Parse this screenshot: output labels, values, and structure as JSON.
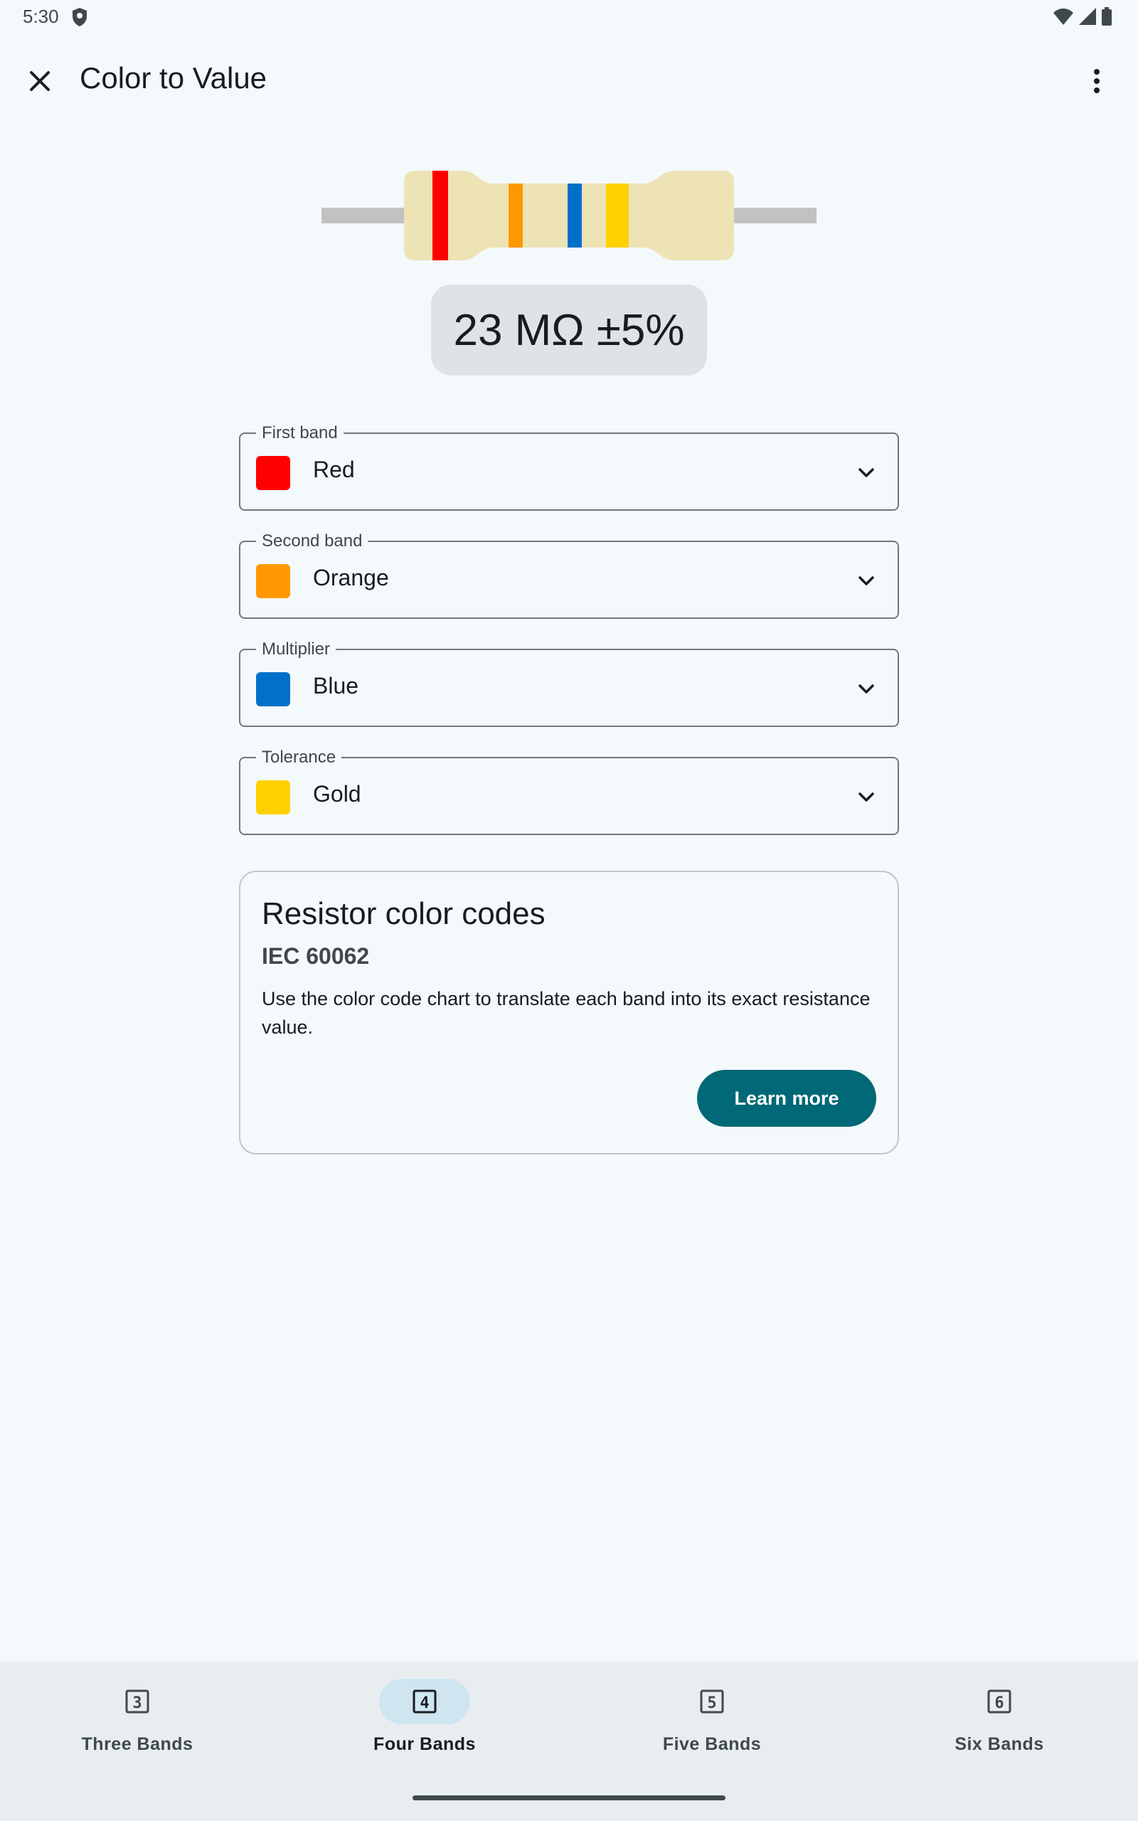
{
  "status_bar": {
    "time": "5:30"
  },
  "app_bar": {
    "title": "Color to Value",
    "close_icon": "close-icon",
    "more_icon": "more-vert-icon"
  },
  "resistor": {
    "body_color": "#ede3b5",
    "lead_color": "#c2c2c2",
    "bands": [
      "#ff0000",
      "#ff9800",
      "#0070c9",
      "#ffd000"
    ]
  },
  "result": {
    "value": "23 MΩ ±5%"
  },
  "fields": [
    {
      "label": "First band",
      "value": "Red",
      "color": "#ff0000"
    },
    {
      "label": "Second band",
      "value": "Orange",
      "color": "#ff9800"
    },
    {
      "label": "Multiplier",
      "value": "Blue",
      "color": "#0070c9"
    },
    {
      "label": "Tolerance",
      "value": "Gold",
      "color": "#ffd000"
    }
  ],
  "card": {
    "title": "Resistor color codes",
    "subtitle": "IEC 60062",
    "body": "Use the color code chart to translate each band into its exact resistance value.",
    "button": "Learn more"
  },
  "bottom_nav": {
    "items": [
      {
        "label": "Three Bands",
        "icon_digit": "3",
        "active": false
      },
      {
        "label": "Four Bands",
        "icon_digit": "4",
        "active": true
      },
      {
        "label": "Five Bands",
        "icon_digit": "5",
        "active": false
      },
      {
        "label": "Six Bands",
        "icon_digit": "6",
        "active": false
      }
    ]
  },
  "colors": {
    "primary": "#006876",
    "background": "#f4f9fb",
    "nav_background": "#e8eef0",
    "nav_active_indicator": "#cfe6f1"
  }
}
